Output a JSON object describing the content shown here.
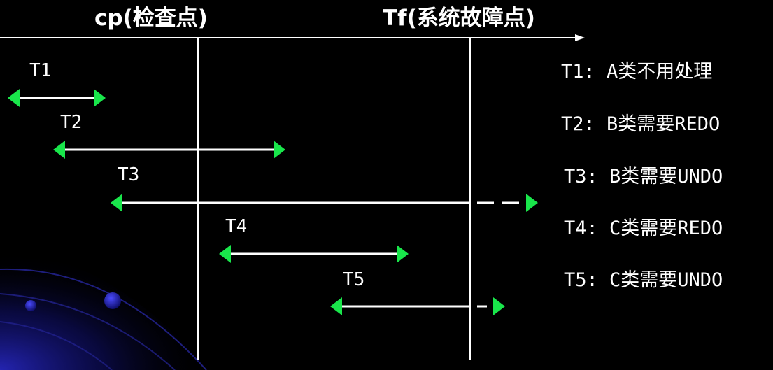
{
  "header": {
    "checkpoint_label": "cp(检查点)",
    "failure_label": "Tf(系统故障点)"
  },
  "transactions": [
    {
      "name": "T1"
    },
    {
      "name": "T2"
    },
    {
      "name": "T3"
    },
    {
      "name": "T4"
    },
    {
      "name": "T5"
    }
  ],
  "legend": [
    "T1: A类不用处理",
    "T2: B类需要REDO",
    "T3: B类需要UNDO",
    "T4: C类需要REDO",
    "T5: C类需要UNDO"
  ],
  "colors": {
    "background": "#000000",
    "line": "#ffffff",
    "arrowhead": "#19e64b",
    "decor": "#1a1a99"
  }
}
